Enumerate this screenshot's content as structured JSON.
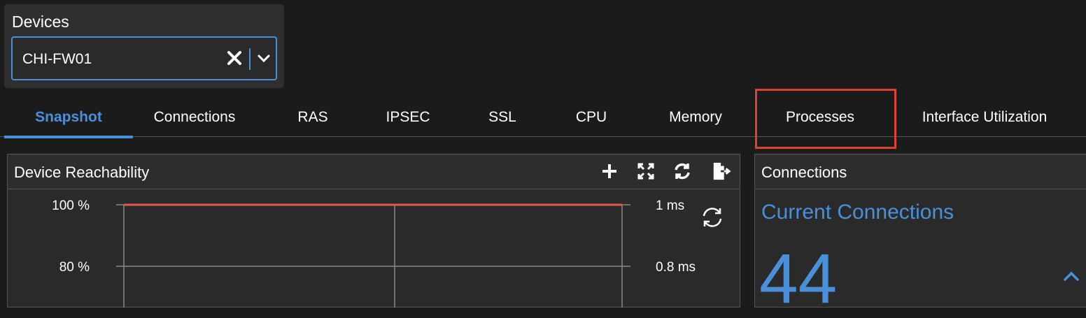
{
  "device_filter": {
    "label": "Devices",
    "selected_value": "CHI-FW01",
    "clear_icon": "close-icon",
    "dropdown_icon": "chevron-down-icon",
    "accent_color": "#4a90d9"
  },
  "tabs": [
    {
      "label": "Snapshot",
      "active": true
    },
    {
      "label": "Connections",
      "active": false
    },
    {
      "label": "RAS",
      "active": false
    },
    {
      "label": "IPSEC",
      "active": false
    },
    {
      "label": "SSL",
      "active": false
    },
    {
      "label": "CPU",
      "active": false
    },
    {
      "label": "Memory",
      "active": false
    },
    {
      "label": "Processes",
      "active": false,
      "highlighted": true
    },
    {
      "label": "Interface Utilization",
      "active": false
    }
  ],
  "highlight_color": "#e0402f",
  "reachability_panel": {
    "title": "Device Reachability",
    "tools": [
      "plus-icon",
      "expand-icon",
      "refresh-icon",
      "export-icon"
    ],
    "refresh_chart_icon": "refresh-icon"
  },
  "connections_panel": {
    "title": "Connections",
    "metric_title": "Current Connections",
    "metric_value": "44",
    "collapse_icon": "chevron-up-icon"
  },
  "chart_data": {
    "type": "line",
    "title": "",
    "y_left": {
      "ticks": [
        "100 %",
        "80 %"
      ],
      "ylim": [
        80,
        100
      ]
    },
    "y_right": {
      "ticks": [
        "1 ms",
        "0.8 ms"
      ],
      "ylim": [
        0.8,
        1
      ]
    },
    "series": [
      {
        "values": [
          100,
          100
        ],
        "color": "#e05a4f"
      }
    ],
    "grid": true
  }
}
